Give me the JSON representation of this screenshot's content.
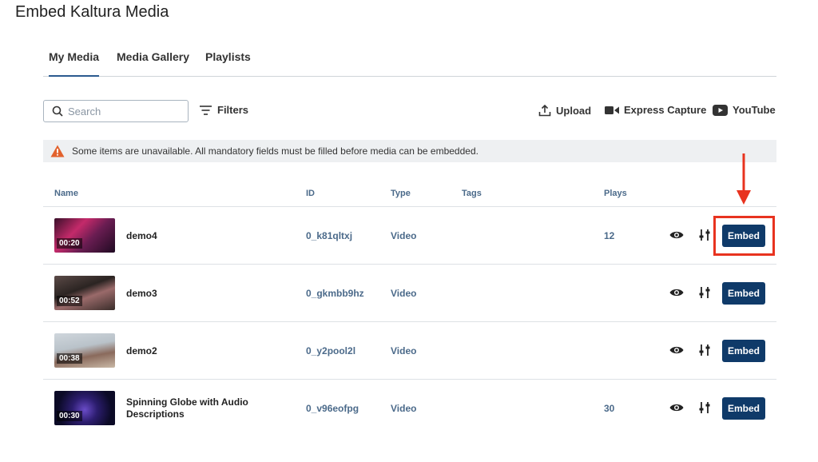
{
  "page": {
    "title": "Embed Kaltura Media"
  },
  "tabs": [
    {
      "label": "My Media",
      "active": true
    },
    {
      "label": "Media Gallery",
      "active": false
    },
    {
      "label": "Playlists",
      "active": false
    }
  ],
  "toolbar": {
    "search_placeholder": "Search",
    "filters_label": "Filters",
    "upload_label": "Upload",
    "express_capture_label": "Express Capture",
    "youtube_label": "YouTube"
  },
  "alert": {
    "text": "Some items are unavailable. All mandatory fields must be filled before media can be embedded."
  },
  "table": {
    "columns": {
      "name": "Name",
      "id": "ID",
      "type": "Type",
      "tags": "Tags",
      "plays": "Plays"
    },
    "rows": [
      {
        "name": "demo4",
        "duration": "00:20",
        "id": "0_k81qltxj",
        "type": "Video",
        "tags": "",
        "plays": "12",
        "embed_label": "Embed"
      },
      {
        "name": "demo3",
        "duration": "00:52",
        "id": "0_gkmbb9hz",
        "type": "Video",
        "tags": "",
        "plays": "",
        "embed_label": "Embed"
      },
      {
        "name": "demo2",
        "duration": "00:38",
        "id": "0_y2pool2l",
        "type": "Video",
        "tags": "",
        "plays": "",
        "embed_label": "Embed"
      },
      {
        "name": "Spinning Globe with Audio Descriptions",
        "duration": "00:30",
        "id": "0_v96eofpg",
        "type": "Video",
        "tags": "",
        "plays": "30",
        "embed_label": "Embed"
      }
    ]
  },
  "colors": {
    "accent": "#0f3a69",
    "annotation": "#e8331f",
    "warning": "#e2622d"
  }
}
